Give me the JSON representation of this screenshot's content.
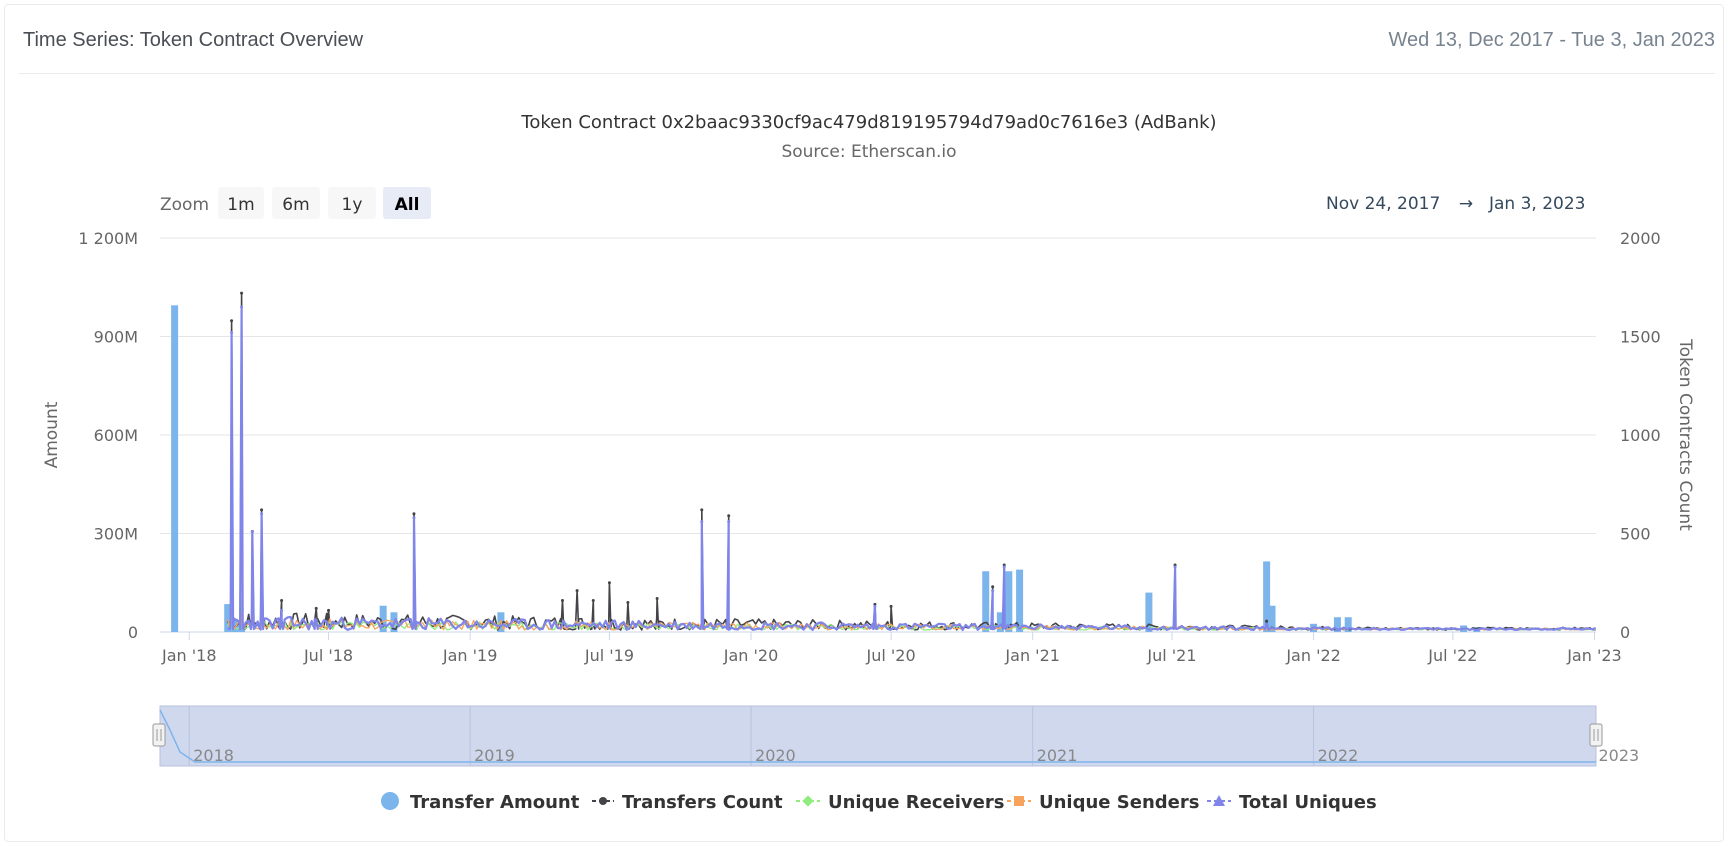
{
  "header": {
    "title": "Time Series: Token Contract Overview",
    "date_range": "Wed 13, Dec 2017 - Tue 3, Jan 2023"
  },
  "range_selector": {
    "zoom_label": "Zoom",
    "buttons": [
      "1m",
      "6m",
      "1y",
      "All"
    ],
    "selected": "All",
    "from": "Nov 24, 2017",
    "arrow": "→",
    "to": "Jan 3, 2023"
  },
  "navigator": {
    "year_labels": [
      "2018",
      "2019",
      "2020",
      "2021",
      "2022",
      "2023"
    ]
  },
  "colors": {
    "transfer_amount": "#7cb5ec",
    "transfers_count": "#434348",
    "unique_receivers": "#90ed7d",
    "unique_senders": "#f7a35c",
    "total_uniques": "#8085e9",
    "navigator_fill": "#d0d8ee"
  },
  "chart_data": {
    "type": "bar",
    "title": "Token Contract 0x2baac9330cf9ac479d819195794d79ad0c7616e3 (AdBank)",
    "subtitle": "Source: Etherscan.io",
    "xlim": [
      "2017-11-24",
      "2023-01-03"
    ],
    "x_ticks": [
      "Jan '18",
      "Jul '18",
      "Jan '19",
      "Jul '19",
      "Jan '20",
      "Jul '20",
      "Jan '21",
      "Jul '21",
      "Jan '22",
      "Jul '22",
      "Jan '23"
    ],
    "y_left": {
      "label": "Amount",
      "ylim": [
        0,
        1200000000
      ],
      "ticks": [
        "0",
        "300M",
        "600M",
        "900M",
        "1 200M"
      ]
    },
    "y_right": {
      "label": "Token Contracts Count",
      "ylim": [
        0,
        2000
      ],
      "ticks": [
        "0",
        "500",
        "1000",
        "1500",
        "2000"
      ]
    },
    "grid": true,
    "legend_position": "bottom-center",
    "series": [
      {
        "name": "Transfer Amount",
        "type": "bar",
        "axis": "left",
        "color": "#7cb5ec",
        "x": [
          "2017-12-13",
          "2018-02-20",
          "2018-03-01",
          "2018-03-10",
          "2018-09-10",
          "2018-09-24",
          "2019-02-10",
          "2020-11-01",
          "2020-11-20",
          "2020-12-01",
          "2020-12-15",
          "2021-06-01",
          "2021-11-01",
          "2021-11-08",
          "2022-01-01",
          "2022-02-01",
          "2022-02-15",
          "2022-07-15",
          "2022-08-01"
        ],
        "values": [
          995000000,
          85000000,
          40000000,
          25000000,
          80000000,
          60000000,
          60000000,
          185000000,
          60000000,
          185000000,
          190000000,
          120000000,
          215000000,
          80000000,
          25000000,
          45000000,
          45000000,
          20000000,
          15000000
        ]
      },
      {
        "name": "Transfers Count",
        "type": "line",
        "axis": "right",
        "color": "#434348",
        "x": [
          "2018-02-25",
          "2018-03-10",
          "2018-03-24",
          "2018-04-05",
          "2018-05-01",
          "2018-06-15",
          "2018-07-01",
          "2018-10-20",
          "2019-05-01",
          "2019-05-20",
          "2019-06-10",
          "2019-07-01",
          "2019-07-25",
          "2019-09-01",
          "2019-10-29",
          "2019-12-03",
          "2020-06-10",
          "2020-07-01",
          "2020-11-10",
          "2020-11-25",
          "2021-07-05",
          "2021-11-01"
        ],
        "values": [
          1580,
          1720,
          510,
          620,
          160,
          120,
          110,
          600,
          160,
          210,
          160,
          250,
          150,
          170,
          620,
          590,
          140,
          130,
          230,
          340,
          340,
          55
        ]
      },
      {
        "name": "Unique Receivers",
        "type": "line",
        "axis": "right",
        "color": "#90ed7d",
        "x": [
          "2018-02-25",
          "2018-03-10",
          "2018-04-05",
          "2018-06-15",
          "2018-10-20",
          "2019-10-29",
          "2020-11-25",
          "2021-07-05"
        ],
        "values": [
          120,
          150,
          80,
          40,
          30,
          30,
          40,
          25
        ]
      },
      {
        "name": "Unique Senders",
        "type": "line",
        "axis": "right",
        "color": "#f7a35c",
        "x": [
          "2018-02-25",
          "2018-03-10",
          "2018-04-05",
          "2018-06-15",
          "2018-10-20",
          "2019-10-29",
          "2020-11-25",
          "2021-07-05"
        ],
        "values": [
          110,
          90,
          60,
          35,
          25,
          25,
          30,
          20
        ]
      },
      {
        "name": "Total Uniques",
        "type": "line",
        "axis": "right",
        "color": "#8085e9",
        "x": [
          "2018-02-25",
          "2018-03-10",
          "2018-03-24",
          "2018-04-05",
          "2018-05-01",
          "2018-06-15",
          "2018-10-20",
          "2019-10-29",
          "2019-12-03",
          "2020-06-10",
          "2020-11-10",
          "2020-11-25",
          "2021-07-05",
          "2021-11-01"
        ],
        "values": [
          1520,
          1650,
          510,
          600,
          110,
          60,
          580,
          560,
          560,
          130,
          210,
          330,
          330,
          40
        ]
      }
    ]
  }
}
